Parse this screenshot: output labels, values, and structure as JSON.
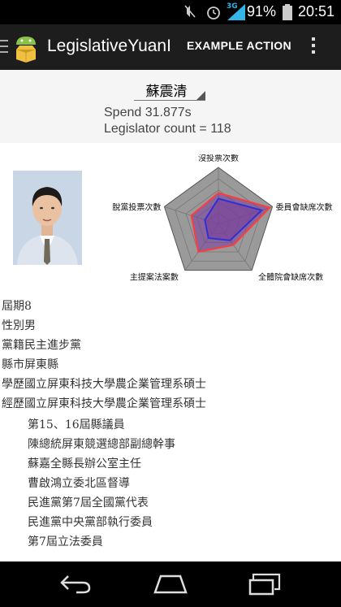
{
  "status_bar": {
    "time": "20:51",
    "battery_percent": "91%",
    "network": "3G",
    "icons": [
      "muted-icon",
      "alarm-icon",
      "signal-icon",
      "battery-icon"
    ]
  },
  "action_bar": {
    "title": "LegislativeYuanI",
    "action_label": "EXAMPLE ACTION",
    "icons": [
      "menu-icon",
      "android-logo-icon",
      "overflow-menu-icon"
    ]
  },
  "legislator_select": {
    "selected": "蘇震清"
  },
  "stats": {
    "spend": "Spend 31.877s",
    "count": "Legislator count = 118"
  },
  "chart_data": {
    "type": "radar",
    "axes": [
      "沒投票次數",
      "委員會缺席次數",
      "全體院會缺席次數",
      "主提案法案數",
      "脫黨投票次數"
    ],
    "grid_levels": 5,
    "series": [
      {
        "values": [
          0.55,
          0.95,
          0.45,
          0.6,
          0.5
        ],
        "color": "#ff3b3b"
      },
      {
        "values": [
          0.45,
          0.8,
          0.35,
          0.3,
          0.25
        ],
        "color": "#2f2fd8"
      }
    ],
    "fill_color": "#7a3d9c",
    "background_color": "#9a9a9a"
  },
  "profile": {
    "lines": [
      "屆期8",
      "性別男",
      "黨籍民主進步黨",
      "縣市屏東縣",
      "學歷國立屏東科技大學農企業管理系碩士",
      "經歷國立屏東科技大學農企業管理系碩士"
    ],
    "experience": [
      "第15、16屆縣議員",
      "陳總統屏東競選總部副總幹事",
      "蘇嘉全縣長辦公室主任",
      "曹啟鴻立委北區督導",
      "民進黨第7屆全國黨代表",
      "民進黨中央黨部執行委員",
      "第7屆立法委員"
    ]
  },
  "nav_bar": {
    "icons": [
      "back-icon",
      "home-icon",
      "recent-apps-icon"
    ]
  }
}
